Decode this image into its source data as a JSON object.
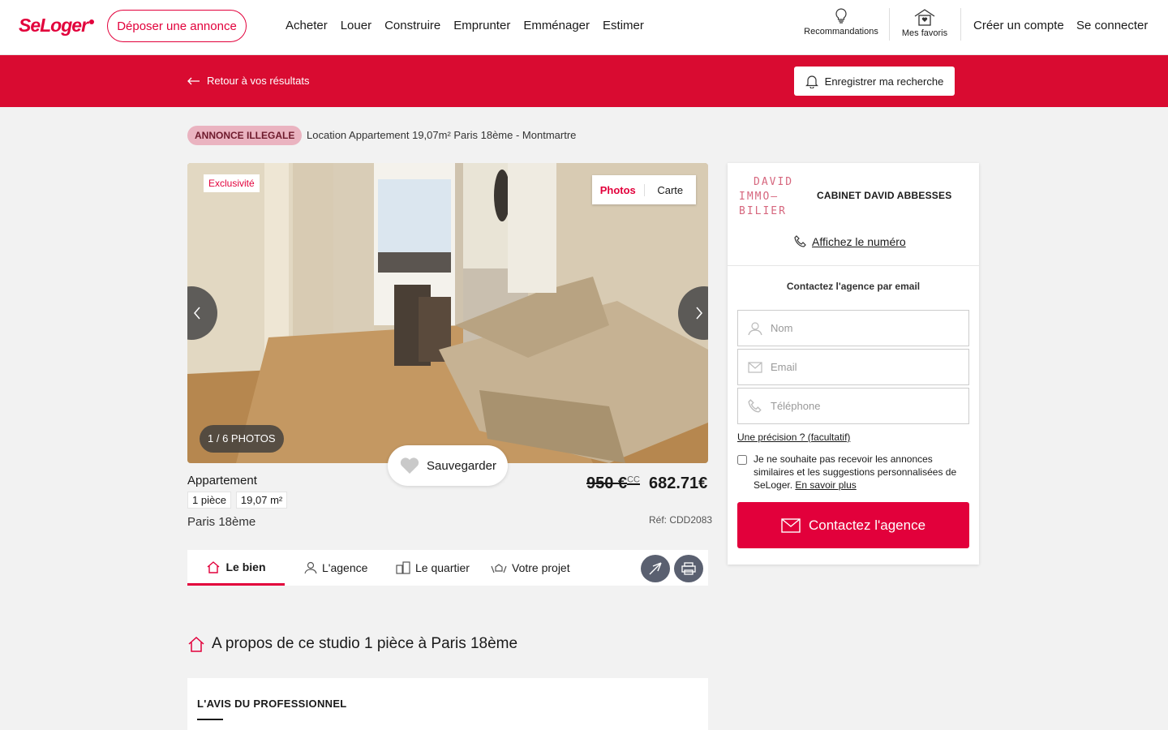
{
  "header": {
    "logo": "SeLoger",
    "post_ad": "Déposer une annonce",
    "menu": [
      "Acheter",
      "Louer",
      "Construire",
      "Emprunter",
      "Emménager",
      "Estimer"
    ],
    "recommendations": "Recommandations",
    "favorites": "Mes favoris",
    "create_account": "Créer un compte",
    "login": "Se connecter"
  },
  "banner": {
    "back": "Retour à vos résultats",
    "save_search": "Enregistrer ma recherche"
  },
  "listing": {
    "badge": "ANNONCE ILLEGALE",
    "title": "Location Appartement 19,07m² Paris 18ème - Montmartre",
    "exclusivity": "Exclusivité",
    "view_tabs": [
      "Photos",
      "Carte"
    ],
    "photo_counter": "1 / 6 PHOTOS",
    "save": "Sauvegarder",
    "type": "Appartement",
    "features": [
      "1 pièce",
      "19,07 m²"
    ],
    "location": "Paris 18ème",
    "old_price": "950 €",
    "old_price_suffix": "CC",
    "price": "682.71€",
    "reference": "Réf: CDD2083"
  },
  "subnav": {
    "tabs": [
      "Le bien",
      "L'agence",
      "Le quartier",
      "Votre projet"
    ]
  },
  "about": {
    "title": "A propos de ce studio 1 pièce à Paris 18ème",
    "pro_opinion": "L'AVIS DU PROFESSIONNEL"
  },
  "agency": {
    "logo_lines": [
      "DAVID",
      "IMMO—",
      "BILIER"
    ],
    "name": "CABINET DAVID ABBESSES",
    "show_number": "Affichez le numéro",
    "contact_title": "Contactez l'agence par email",
    "fields": {
      "name_placeholder": "Nom",
      "email_placeholder": "Email",
      "phone_placeholder": "Téléphone"
    },
    "precision": "Une précision ? (facultatif)",
    "optout_text": "Je ne souhaite pas recevoir les annonces similaires et les suggestions personnalisées de SeLoger.",
    "learn_more": "En savoir plus",
    "contact_button": "Contactez l'agence"
  },
  "colors": {
    "brand": "#e2003b",
    "banner": "#d90b31",
    "badge_bg": "#eab3c0"
  }
}
